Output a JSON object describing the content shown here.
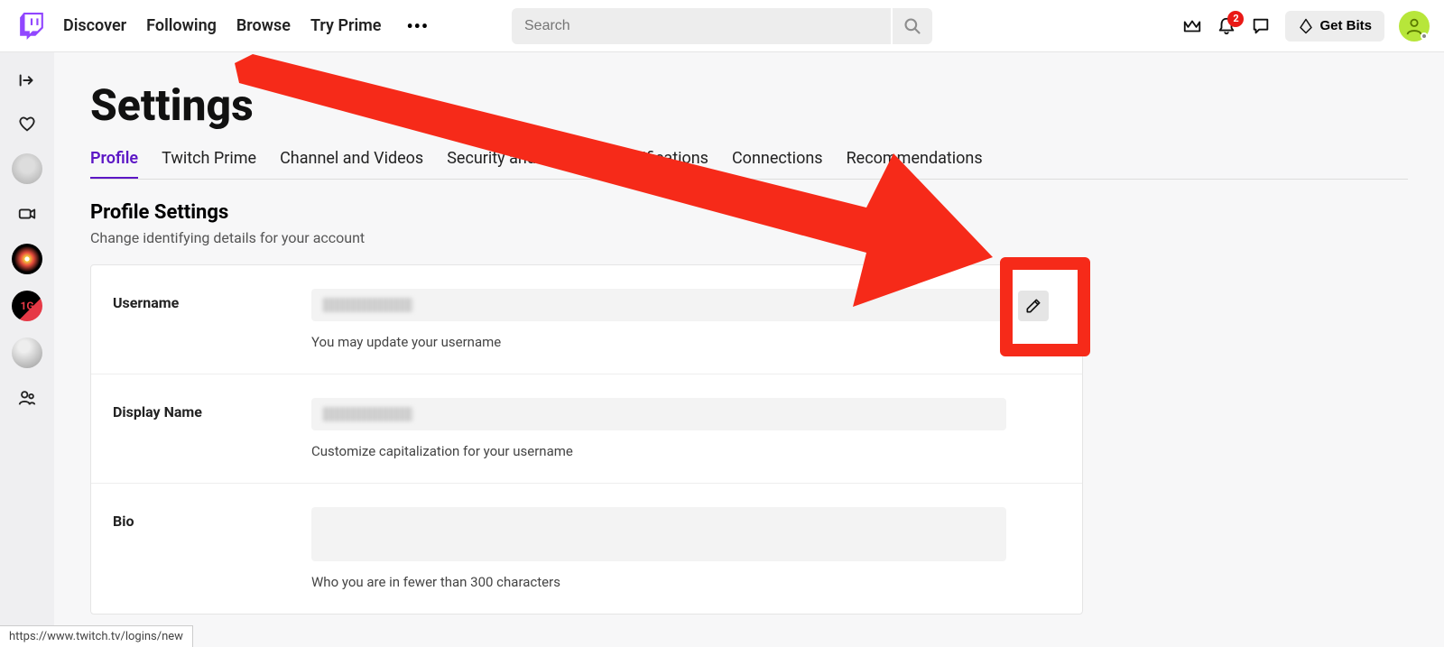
{
  "nav": {
    "links": [
      "Discover",
      "Following",
      "Browse",
      "Try Prime"
    ],
    "search_placeholder": "Search",
    "notification_count": "2",
    "bits_label": "Get Bits"
  },
  "page": {
    "title": "Settings",
    "tabs": [
      "Profile",
      "Twitch Prime",
      "Channel and Videos",
      "Security and Privacy",
      "Notifications",
      "Connections",
      "Recommendations"
    ],
    "active_tab": "Profile"
  },
  "section": {
    "title": "Profile Settings",
    "subtitle": "Change identifying details for your account"
  },
  "rows": {
    "username": {
      "label": "Username",
      "hint": "You may update your username"
    },
    "display_name": {
      "label": "Display Name",
      "hint": "Customize capitalization for your username"
    },
    "bio": {
      "label": "Bio",
      "hint": "Who you are in fewer than 300 characters"
    }
  },
  "status_url": "https://www.twitch.tv/logins/new"
}
